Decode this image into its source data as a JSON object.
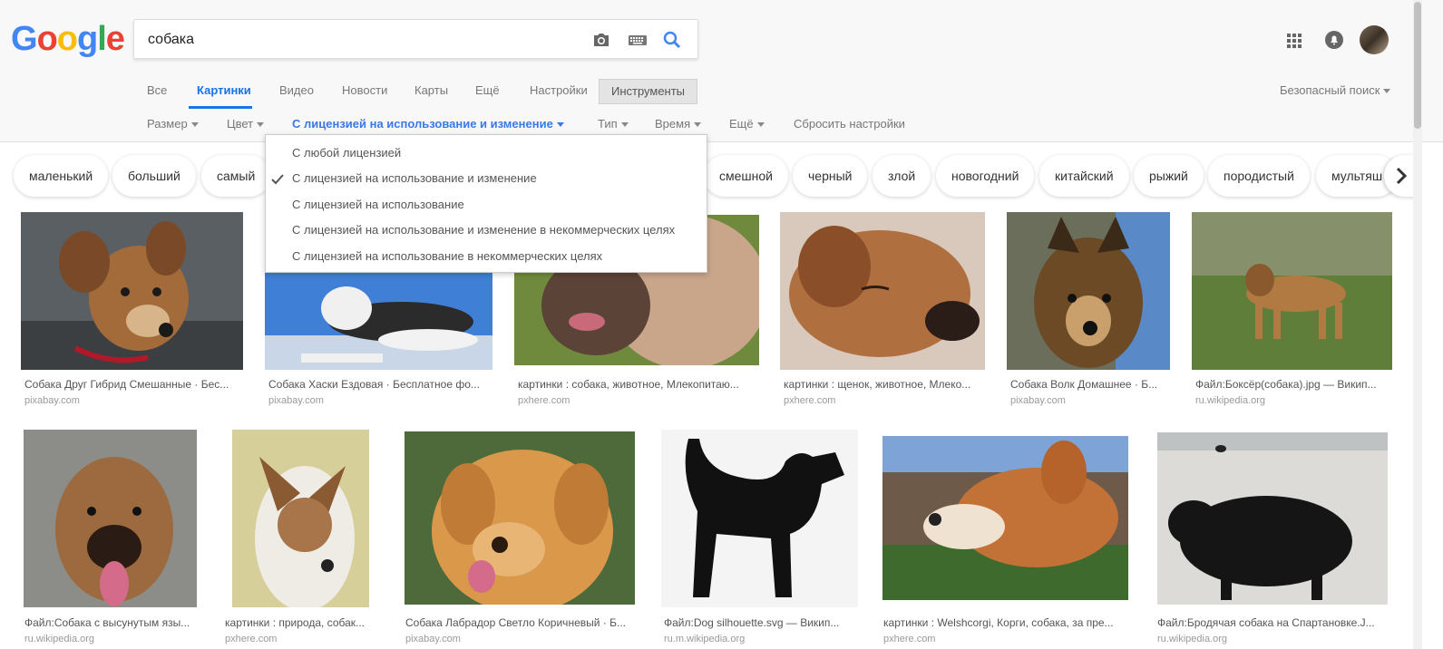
{
  "logo": {
    "letters": [
      "G",
      "o",
      "o",
      "g",
      "l",
      "e"
    ],
    "colors": [
      "#4285f4",
      "#ea4335",
      "#fbbc05",
      "#4285f4",
      "#34a853",
      "#ea4335"
    ]
  },
  "search": {
    "value": "собака"
  },
  "icons": {
    "camera": "camera-icon",
    "keyboard": "keyboard-icon",
    "search": "search-icon",
    "apps": "apps-grid-icon",
    "notifications": "notifications-icon"
  },
  "tabs": [
    {
      "label": "Все"
    },
    {
      "label": "Картинки",
      "active": true
    },
    {
      "label": "Видео"
    },
    {
      "label": "Новости"
    },
    {
      "label": "Карты"
    },
    {
      "label": "Ещё"
    },
    {
      "label": "Настройки"
    }
  ],
  "tools_label": "Инструменты",
  "safe_search_label": "Безопасный поиск",
  "filters": [
    {
      "label": "Размер"
    },
    {
      "label": "Цвет"
    },
    {
      "label": "С лицензией на использование и изменение",
      "active": true
    },
    {
      "label": "Тип"
    },
    {
      "label": "Время"
    },
    {
      "label": "Ещё"
    }
  ],
  "reset_label": "Сбросить настройки",
  "license_menu": {
    "options": [
      "С любой лицензией",
      "С лицензией на использование и изменение",
      "С лицензией на использование",
      "С лицензией на использование и изменение в некоммерческих целях",
      "С лицензией на использование в некоммерческих целях"
    ],
    "selected_index": 1
  },
  "chips": [
    "маленький",
    "больший",
    "самый",
    "смешной",
    "черный",
    "злой",
    "новогодний",
    "китайский",
    "рыжий",
    "породистый",
    "мультяш"
  ],
  "results_row1": [
    {
      "caption": "Собака Друг Гибрид Смешанные · Бес...",
      "source": "pixabay.com"
    },
    {
      "caption": "Собака Хаски Ездовая · Бесплатное фо...",
      "source": "pixabay.com"
    },
    {
      "caption": "картинки : собака, животное, Млекопитаю...",
      "source": "pxhere.com"
    },
    {
      "caption": "картинки : щенок, животное, Млеко...",
      "source": "pxhere.com"
    },
    {
      "caption": "Собака Волк Домашнее · Б...",
      "source": "pixabay.com"
    },
    {
      "caption": "Файл:Боксёр(собака).jpg — Викип...",
      "source": "ru.wikipedia.org"
    }
  ],
  "results_row2": [
    {
      "caption": "Файл:Собака с высунутым язы...",
      "source": "ru.wikipedia.org"
    },
    {
      "caption": "картинки : природа, собак...",
      "source": "pxhere.com"
    },
    {
      "caption": "Собака Лабрадор Светло Коричневый · Б...",
      "source": "pixabay.com"
    },
    {
      "caption": "Файл:Dog silhouette.svg — Викип...",
      "source": "ru.m.wikipedia.org"
    },
    {
      "caption": "картинки : Welshcorgi, Корги, собака, за пре...",
      "source": "pxhere.com"
    },
    {
      "caption": "Файл:Бродячая собака на Спартановке.J...",
      "source": "ru.wikipedia.org"
    }
  ]
}
